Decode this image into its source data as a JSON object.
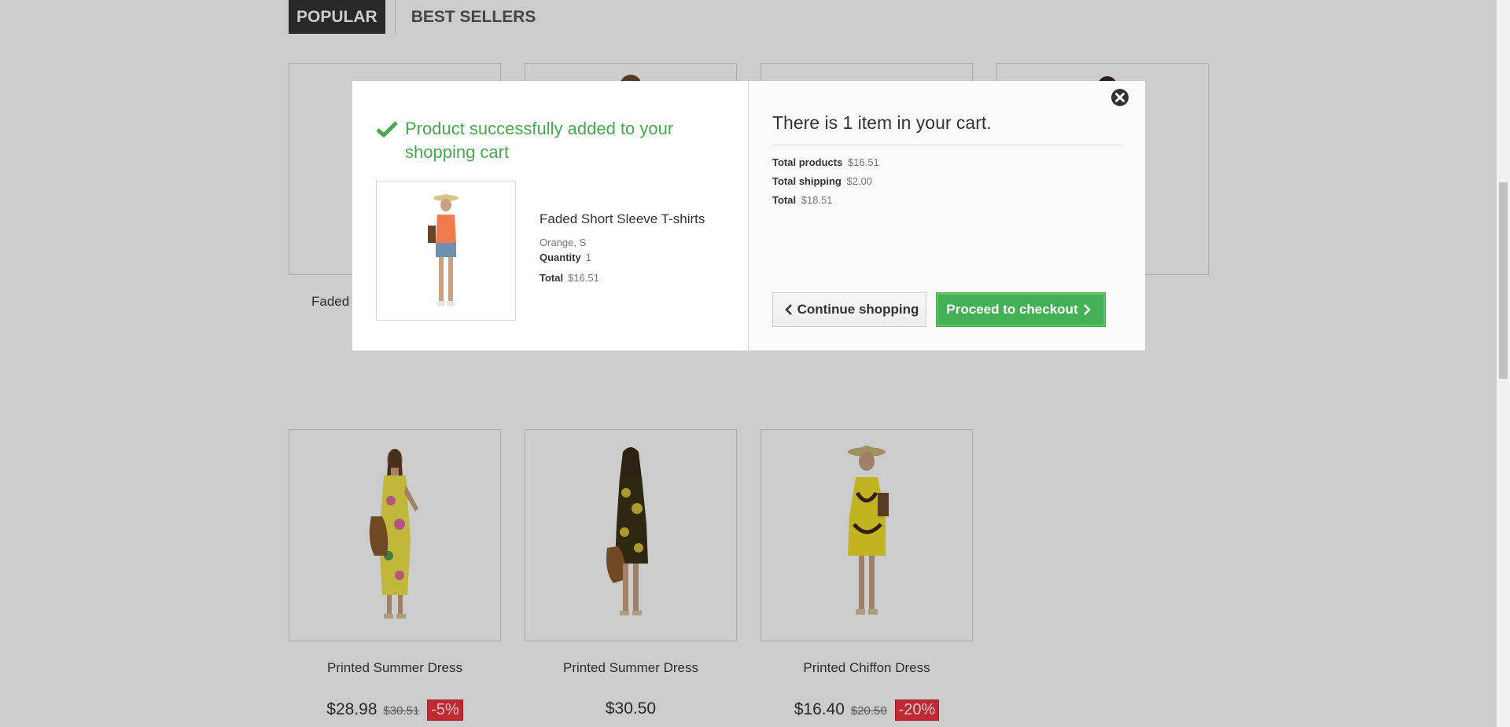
{
  "tabs": {
    "popular": "Popular",
    "best_sellers": "Best Sellers"
  },
  "top_row": [
    {
      "name": "Faded"
    }
  ],
  "products": [
    {
      "name": "Printed Summer Dress",
      "price": "$28.98",
      "old_price": "$30.51",
      "discount": "-5%"
    },
    {
      "name": "Printed Summer Dress",
      "price": "$30.50",
      "old_price": "",
      "discount": ""
    },
    {
      "name": "Printed Chiffon Dress",
      "price": "$16.40",
      "old_price": "$20.50",
      "discount": "-20%"
    }
  ],
  "modal": {
    "success_title": "Product successfully added to your shopping cart",
    "product": {
      "name": "Faded Short Sleeve T-shirts",
      "attributes": "Orange, S",
      "quantity_label": "Quantity",
      "quantity": "1",
      "total_label": "Total",
      "total": "$16.51"
    },
    "cart_count_text": "There is 1 item in your cart.",
    "totals": {
      "products_label": "Total products",
      "products": "$16.51",
      "shipping_label": "Total shipping",
      "shipping": "$2.00",
      "total_label": "Total",
      "total": "$18.51"
    },
    "continue_label": "Continue shopping",
    "checkout_label": "Proceed to checkout"
  },
  "colors": {
    "success_green": "#46a74e",
    "checkout_green": "#43b155",
    "discount_red": "#f13340"
  }
}
